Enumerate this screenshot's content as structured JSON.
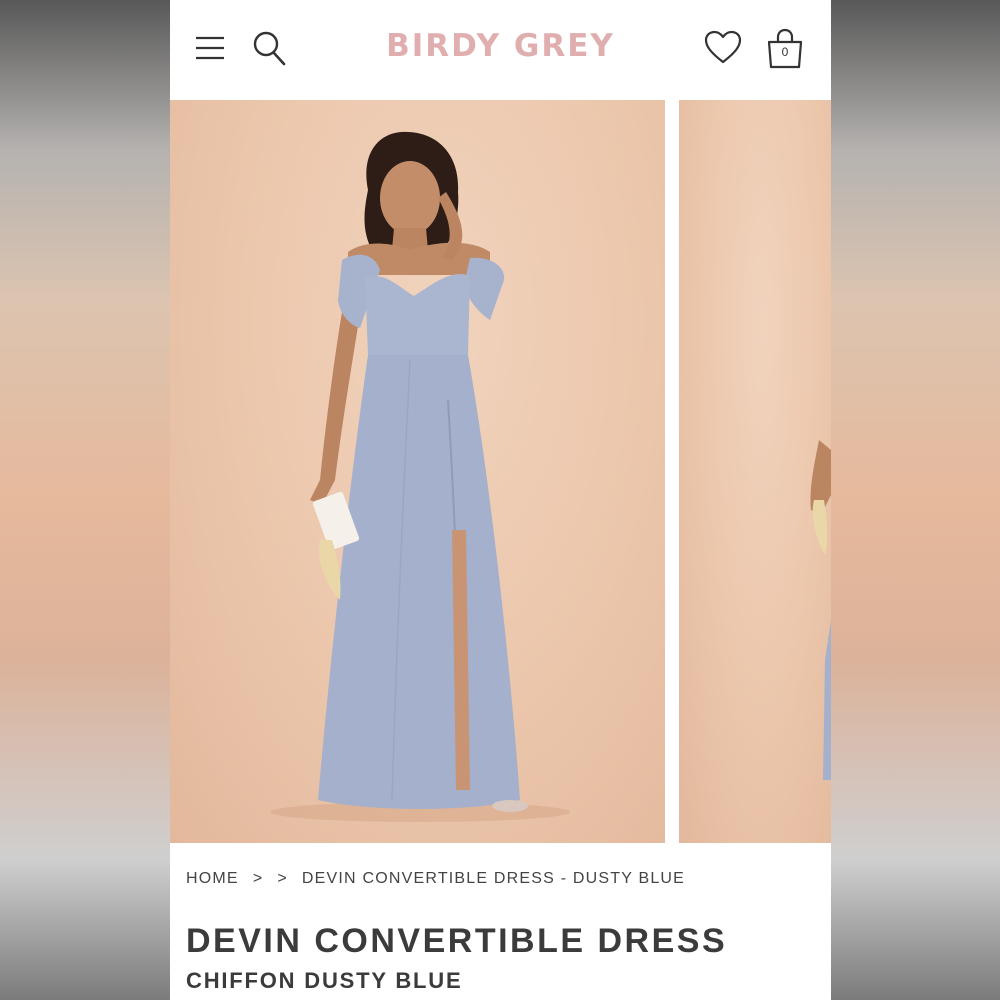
{
  "header": {
    "brand": "BIRDY GREY",
    "menu_icon": "menu-icon",
    "search_icon": "search-icon",
    "wishlist_icon": "heart-icon",
    "cart_icon": "bag-icon",
    "cart_count": "0"
  },
  "gallery": {
    "images": [
      {
        "alt": "Model wearing dusty blue off-shoulder chiffon maxi dress",
        "dress_color": "#a9b4cf"
      },
      {
        "alt": "Next product image",
        "dress_color": "#a9b4cf"
      }
    ],
    "background_color": "#ebc6ab"
  },
  "breadcrumb": {
    "items": [
      "HOME",
      ">",
      ">",
      "DEVIN CONVERTIBLE DRESS - DUSTY BLUE"
    ]
  },
  "product": {
    "title": "DEVIN CONVERTIBLE DRESS",
    "subtitle": "CHIFFON DUSTY BLUE"
  },
  "colors": {
    "brand": "#e0aeae",
    "text": "#3b3b3b"
  }
}
